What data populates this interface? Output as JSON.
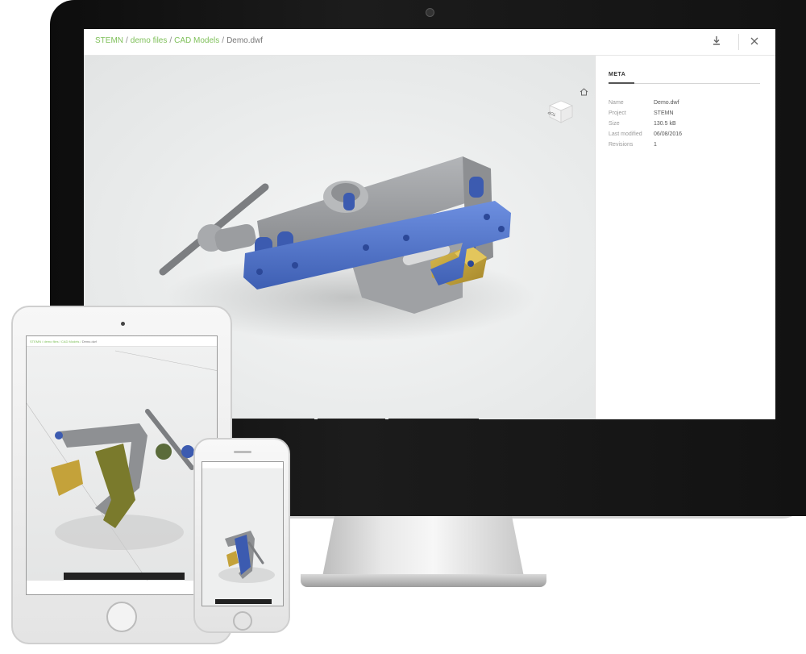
{
  "breadcrumb": [
    {
      "label": "STEMN",
      "link": true
    },
    {
      "label": "demo files",
      "link": true
    },
    {
      "label": "CAD Models",
      "link": true
    },
    {
      "label": "Demo.dwf",
      "link": false
    }
  ],
  "sidebar": {
    "tab_label": "META",
    "rows": [
      {
        "label": "Name",
        "value": "Demo.dwf"
      },
      {
        "label": "Project",
        "value": "STEMN"
      },
      {
        "label": "Size",
        "value": "130.5 kB"
      },
      {
        "label": "Last modified",
        "value": "06/08/2016"
      },
      {
        "label": "Revisions",
        "value": "1"
      }
    ]
  },
  "viewcube_label": "TOP",
  "icons": {
    "download": "download-icon",
    "close": "close-icon",
    "home": "home-icon"
  },
  "toolbar_groups": [
    [
      "hand-pan-icon",
      "dolly-arrows-icon",
      "person-walk-icon",
      "rotate-history-icon"
    ],
    [
      "explode-icon",
      "measure-icon",
      "section-cube-icon"
    ],
    [
      "model-tree-icon",
      "properties-icon",
      "settings-gear-icon",
      "fullscreen-icon"
    ]
  ],
  "colors": {
    "accent_link": "#7fc05a",
    "toolbar_bg": "#222222",
    "blue_part": "#4f73c9",
    "gold_part": "#c7a63a",
    "grey_part": "#9a9c9e"
  }
}
